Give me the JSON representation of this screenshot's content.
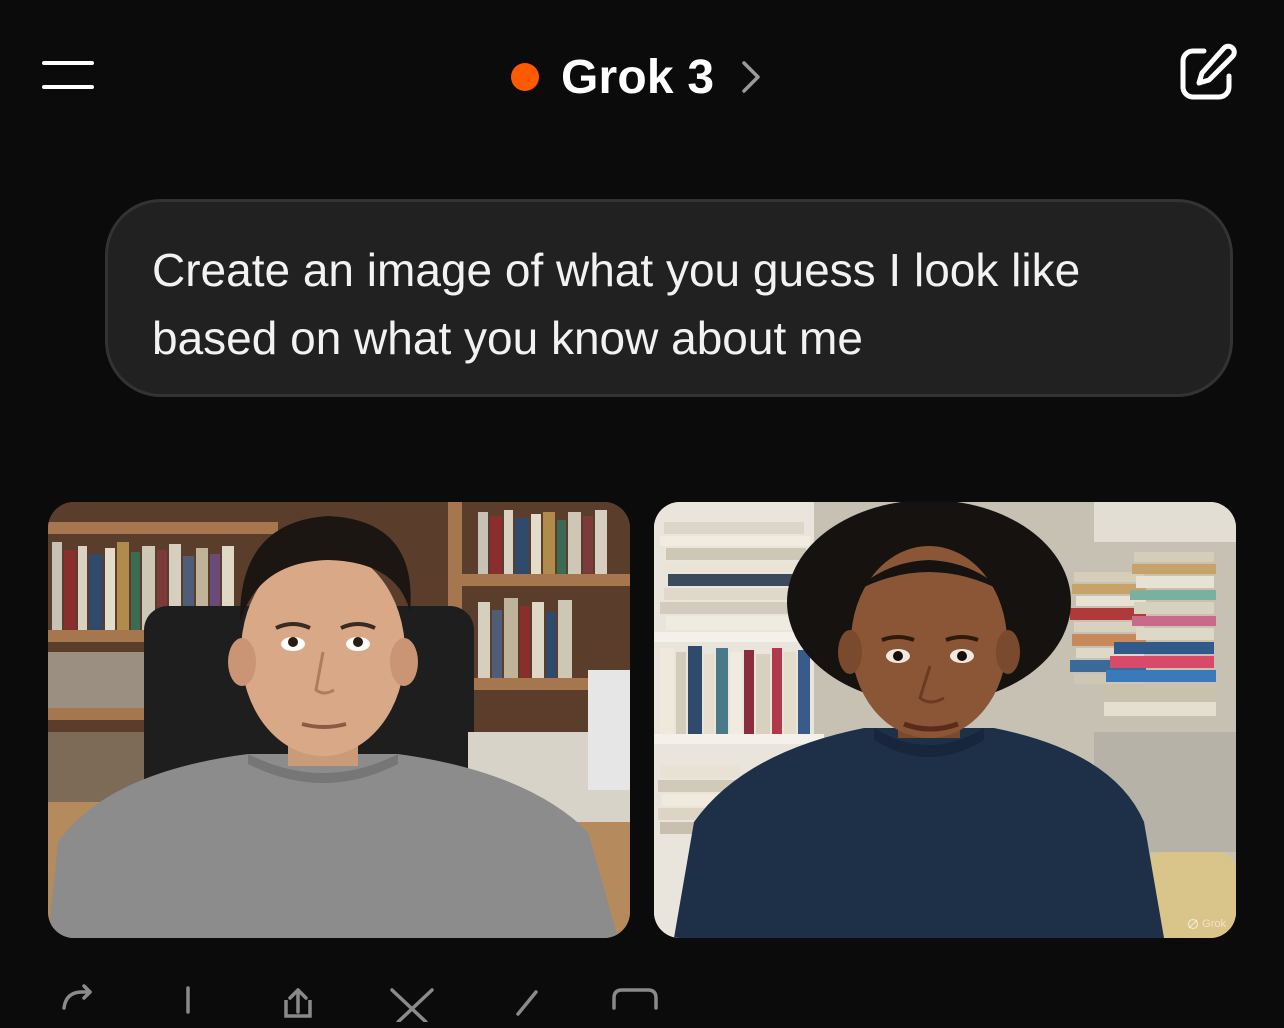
{
  "header": {
    "menu_icon": "hamburger-menu-icon",
    "model_name": "Grok 3",
    "status_color": "#ff5a00",
    "chevron_icon": "chevron-right-icon",
    "new_chat_icon": "edit-new-chat-icon"
  },
  "conversation": {
    "user_message": "Create an image of what you guess I look like based on what you know about me",
    "images": [
      {
        "description_icon": "generated-image"
      },
      {
        "description_icon": "generated-image"
      }
    ],
    "watermark": "Grok"
  },
  "actions": [
    {
      "icon": "regenerate-icon"
    },
    {
      "icon": "download-icon"
    },
    {
      "icon": "share-icon"
    },
    {
      "icon": "x-post-icon"
    },
    {
      "icon": "edit-icon"
    },
    {
      "icon": "copy-icon"
    }
  ],
  "colors": {
    "background": "#0b0b0b",
    "bubble": "#212121",
    "accent": "#ff5a00"
  }
}
